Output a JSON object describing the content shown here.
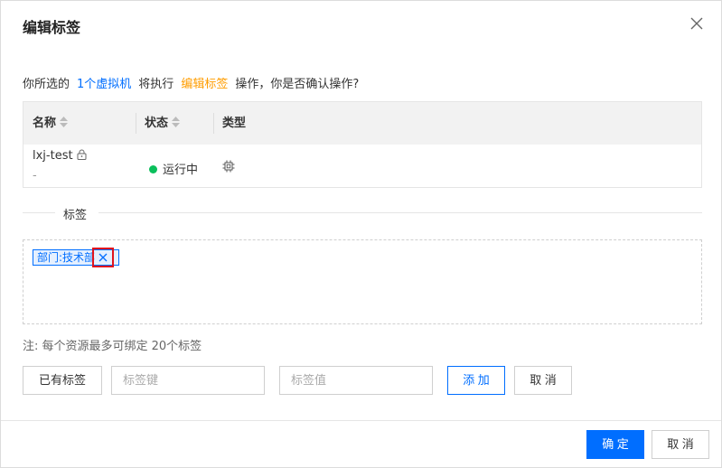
{
  "dialog": {
    "title": "编辑标签",
    "close_icon": "close-icon"
  },
  "confirm": {
    "prefix": "你所选的",
    "target": "1个虚拟机",
    "middle": "将执行",
    "action": "编辑标签",
    "suffix": "操作，你是否确认操作?"
  },
  "table": {
    "columns": [
      {
        "label": "名称",
        "sortable": true
      },
      {
        "label": "状态",
        "sortable": true
      },
      {
        "label": "类型",
        "sortable": false
      }
    ],
    "rows": [
      {
        "name": "lxj-test",
        "sub": "-",
        "status": "运行中",
        "status_color": "#0abf5b",
        "type_icon": "chip-icon"
      }
    ]
  },
  "tags_section": {
    "label": "标签",
    "tags": [
      {
        "text": "部门:技术部"
      }
    ],
    "note": "注: 每个资源最多可绑定 20个标签"
  },
  "form": {
    "existing_tags_label": "已有标签",
    "key_placeholder": "标签键",
    "value_placeholder": "标签值",
    "add_label": "添 加",
    "cancel_label": "取 消"
  },
  "footer": {
    "ok_label": "确 定",
    "cancel_label": "取 消"
  },
  "colors": {
    "accent": "#006eff",
    "warning": "#ff9d00",
    "running": "#0abf5b",
    "highlight": "#e0141e"
  }
}
